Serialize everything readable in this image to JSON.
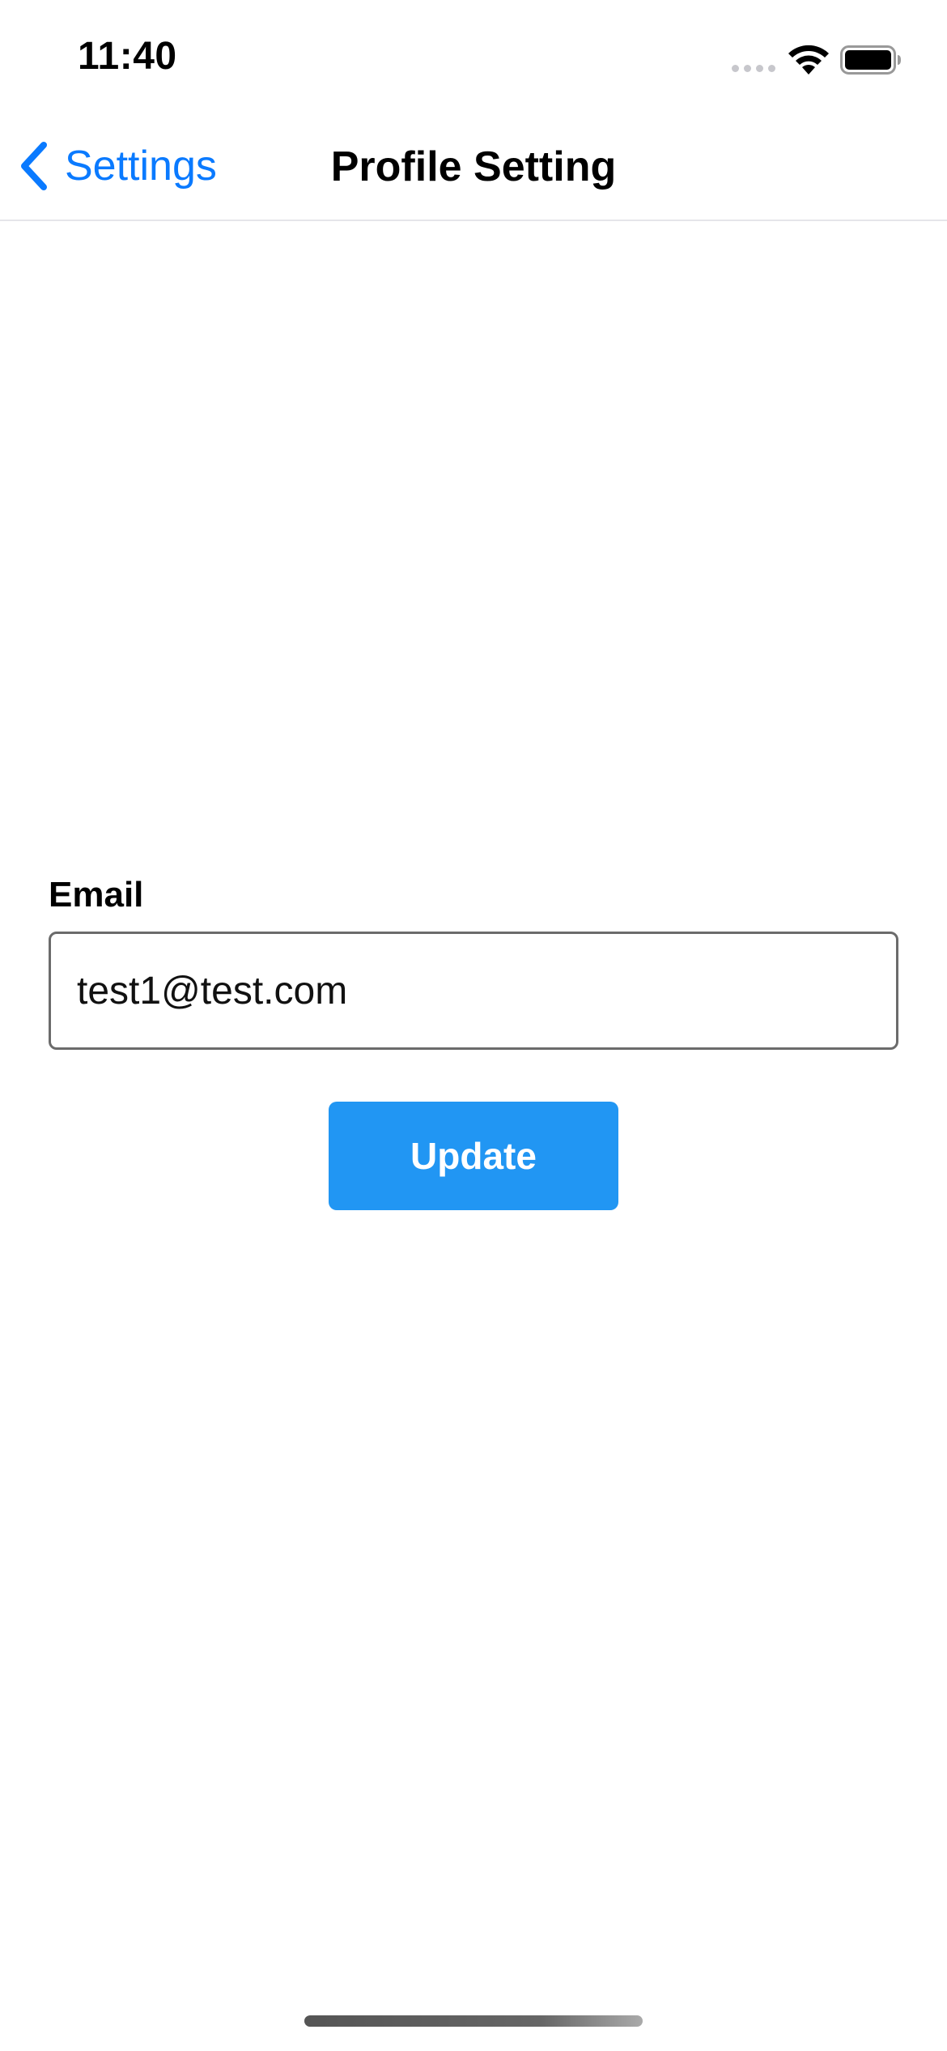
{
  "status_bar": {
    "time": "11:40",
    "icons": [
      "cellular-signal-icon",
      "wifi-icon",
      "battery-icon"
    ]
  },
  "nav": {
    "back_label": "Settings",
    "back_icon": "chevron-left-icon",
    "title": "Profile Setting"
  },
  "form": {
    "email_label": "Email",
    "email_value": "test1@test.com",
    "submit_label": "Update"
  },
  "colors": {
    "accent": "#0a7aff",
    "button": "#2196f3",
    "button_text": "#ffffff",
    "field_border": "#6b6b6b"
  }
}
